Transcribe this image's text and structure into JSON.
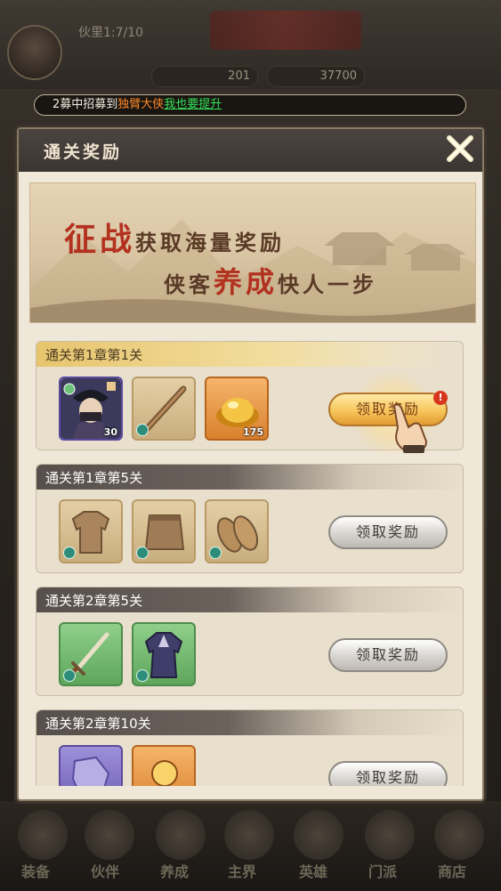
{
  "background": {
    "player_name": "伙里1:7/10",
    "resource_1": "201",
    "resource_2": "37700",
    "tabs": [
      "装备",
      "伙伴",
      "养成",
      "主界",
      "英雄",
      "门派",
      "商店"
    ]
  },
  "marquee": {
    "prefix": "2募中招募到",
    "highlight": "独臂大侠",
    "link": "我也要提升"
  },
  "dialog": {
    "title": "通关奖励",
    "banner": {
      "line1_big": "征战",
      "line1_rest": "获取海量奖励",
      "line2_a": "侠客",
      "line2_big": "养成",
      "line2_b": "快人一步"
    },
    "rewards": [
      {
        "title": "通关第1章第1关",
        "button": "领取奖励",
        "alert": "!",
        "items": [
          {
            "icon": "hero-portrait-icon",
            "qty": "30"
          },
          {
            "icon": "wooden-staff-icon",
            "qty": ""
          },
          {
            "icon": "gold-ingot-icon",
            "qty": "175"
          }
        ]
      },
      {
        "title": "通关第1章第5关",
        "button": "领取奖励",
        "items": [
          {
            "icon": "cloth-shirt-icon",
            "qty": ""
          },
          {
            "icon": "cloth-skirt-icon",
            "qty": ""
          },
          {
            "icon": "straw-sandals-icon",
            "qty": ""
          }
        ]
      },
      {
        "title": "通关第2章第5关",
        "button": "领取奖励",
        "items": [
          {
            "icon": "sword-icon",
            "qty": ""
          },
          {
            "icon": "robe-icon",
            "qty": ""
          }
        ]
      },
      {
        "title": "通关第2章第10关",
        "button": "领取奖励",
        "items": [
          {
            "icon": "hero-shard-icon",
            "qty": ""
          },
          {
            "icon": "elixir-orb-icon",
            "qty": ""
          }
        ]
      }
    ]
  }
}
